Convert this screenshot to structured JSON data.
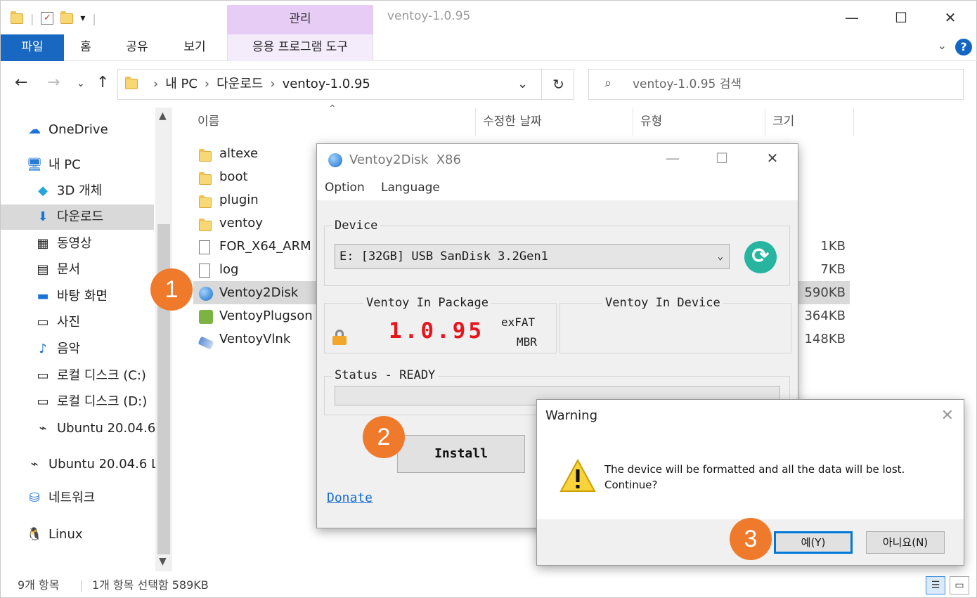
{
  "window": {
    "title": "ventoy-1.0.95",
    "context_tab": "관리",
    "buttons": {
      "minimize": "—",
      "maximize": "☐",
      "close": "✕"
    }
  },
  "ribbon": {
    "tabs": [
      "파일",
      "홈",
      "공유",
      "보기",
      "응용 프로그램 도구"
    ]
  },
  "address": {
    "crumbs": [
      "내 PC",
      "다운로드",
      "ventoy-1.0.95"
    ]
  },
  "search": {
    "placeholder": "ventoy-1.0.95 검색"
  },
  "nav": {
    "items": [
      {
        "label": "OneDrive",
        "icon": "cloud-icon"
      },
      {
        "label": "내 PC",
        "icon": "pc-icon"
      },
      {
        "label": "3D 개체",
        "icon": "cube-icon"
      },
      {
        "label": "다운로드",
        "icon": "download-icon"
      },
      {
        "label": "동영상",
        "icon": "film-icon"
      },
      {
        "label": "문서",
        "icon": "document-icon"
      },
      {
        "label": "바탕 화면",
        "icon": "desktop-icon"
      },
      {
        "label": "사진",
        "icon": "picture-icon"
      },
      {
        "label": "음악",
        "icon": "music-icon"
      },
      {
        "label": "로컬 디스크 (C:)",
        "icon": "disk-icon"
      },
      {
        "label": "로컬 디스크 (D:)",
        "icon": "disk-icon"
      },
      {
        "label": "Ubuntu 20.04.6",
        "icon": "usb-icon"
      },
      {
        "label": "Ubuntu 20.04.6 L",
        "icon": "usb-icon"
      },
      {
        "label": "네트워크",
        "icon": "network-icon"
      },
      {
        "label": "Linux",
        "icon": "linux-icon"
      }
    ]
  },
  "columns": [
    "이름",
    "수정한 날짜",
    "유형",
    "크기"
  ],
  "files": [
    {
      "name": "altexe",
      "size": ""
    },
    {
      "name": "boot",
      "size": ""
    },
    {
      "name": "plugin",
      "size": ""
    },
    {
      "name": "ventoy",
      "size": ""
    },
    {
      "name": "FOR_X64_ARM",
      "size": "1KB"
    },
    {
      "name": "log",
      "size": "7KB"
    },
    {
      "name": "Ventoy2Disk",
      "size": "590KB"
    },
    {
      "name": "VentoyPlugson",
      "size": "364KB"
    },
    {
      "name": "VentoyVlnk",
      "size": "148KB"
    }
  ],
  "status": {
    "count": "9개 항목",
    "selected": "1개 항목 선택함 589KB"
  },
  "ventoy": {
    "title": "Ventoy2Disk",
    "arch": "X86",
    "menu": [
      "Option",
      "Language"
    ],
    "device_label": "Device",
    "device_value": "E: [32GB] USB SanDisk 3.2Gen1",
    "in_package_label": "Ventoy In Package",
    "in_device_label": "Ventoy In Device",
    "version": "1.0.95",
    "fs": "exFAT",
    "partition": "MBR",
    "status_label": "Status - READY",
    "install_label": "Install",
    "donate_label": "Donate"
  },
  "warning": {
    "title": "Warning",
    "message_line1": "The device will be formatted and all the data will be lost.",
    "message_line2": "Continue?",
    "yes_label": "예(Y)",
    "no_label": "아니요(N)"
  },
  "badges": [
    "1",
    "2",
    "3"
  ],
  "colors": {
    "accent": "#1867c0",
    "badge": "#f07a2c",
    "version": "#e8141b",
    "context_tab": "#e7ccf5"
  }
}
